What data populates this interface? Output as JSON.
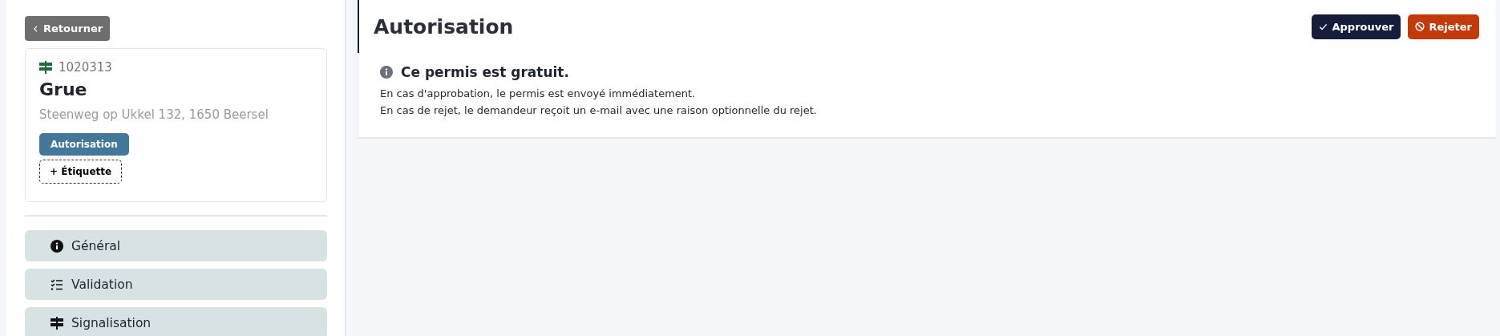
{
  "sidebar": {
    "back_button": "Retourner",
    "card": {
      "number": "1020313",
      "title": "Grue",
      "address": "Steenweg op Ukkel 132, 1650 Beersel",
      "tags": [
        "Autorisation"
      ],
      "add_tag": "+ Étiquette"
    },
    "nav": [
      {
        "kind": "info",
        "label": "Général"
      },
      {
        "kind": "checklist",
        "label": "Validation"
      },
      {
        "kind": "sign",
        "label": "Signalisation"
      }
    ]
  },
  "main": {
    "title": "Autorisation",
    "buttons": [
      {
        "kind": "approve",
        "label": "Approuver"
      },
      {
        "kind": "reject",
        "label": "Rejeter"
      }
    ],
    "notice": {
      "heading": "Ce permis est gratuit.",
      "lines": [
        "En cas d'approbation, le permis est envoyé immédiatement.",
        "En cas de rejet, le demandeur reçoit un e-mail avec une raison optionnelle du rejet."
      ]
    }
  }
}
